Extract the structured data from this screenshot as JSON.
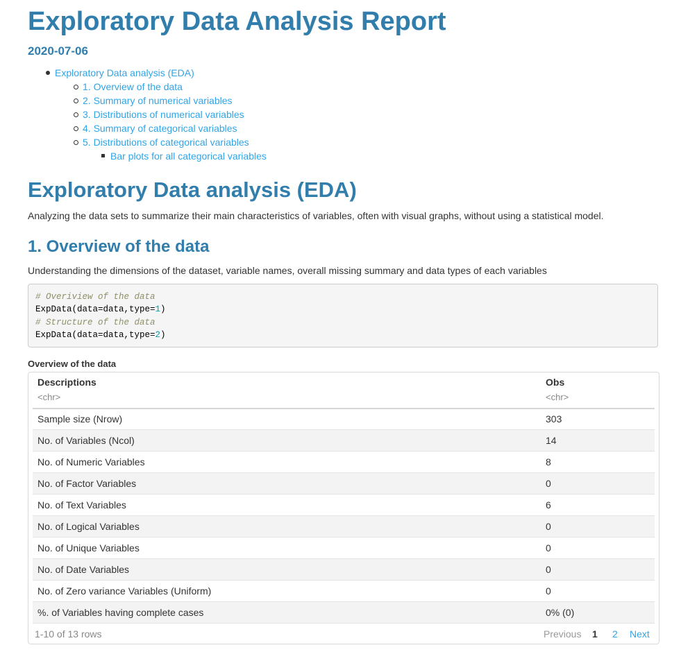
{
  "title": "Exploratory Data Analysis Report",
  "date": "2020-07-06",
  "toc": {
    "items": [
      {
        "label": "Exploratory Data analysis (EDA)"
      },
      {
        "label": "1. Overview of the data"
      },
      {
        "label": "2. Summary of numerical variables"
      },
      {
        "label": "3. Distributions of numerical variables"
      },
      {
        "label": "4. Summary of categorical variables"
      },
      {
        "label": "5. Distributions of categorical variables"
      },
      {
        "label": "Bar plots for all categorical variables"
      }
    ]
  },
  "eda": {
    "heading": "Exploratory Data analysis (EDA)",
    "description": "Analyzing the data sets to summarize their main characteristics of variables, often with visual graphs, without using a statistical model."
  },
  "overview": {
    "heading": "1. Overview of the data",
    "description": "Understanding the dimensions of the dataset, variable names, overall missing summary and data types of each variables",
    "code": {
      "comment1": "# Overiview of the data",
      "line1_prefix": "ExpData(data=data,type=",
      "line1_num": "1",
      "line1_suffix": ")",
      "comment2": "# Structure of the data",
      "line2_prefix": "ExpData(data=data,type=",
      "line2_num": "2",
      "line2_suffix": ")"
    },
    "table_caption": "Overview of the data"
  },
  "table": {
    "columns": [
      {
        "name": "Descriptions",
        "type": "<chr>"
      },
      {
        "name": "Obs",
        "type": "<chr>"
      }
    ],
    "rows": [
      [
        "Sample size (Nrow)",
        "303"
      ],
      [
        "No. of Variables (Ncol)",
        "14"
      ],
      [
        "No. of Numeric Variables",
        "8"
      ],
      [
        "No. of Factor Variables",
        "0"
      ],
      [
        "No. of Text Variables",
        "6"
      ],
      [
        "No. of Logical Variables",
        "0"
      ],
      [
        "No. of Unique Variables",
        "0"
      ],
      [
        "No. of Date Variables",
        "0"
      ],
      [
        "No. of Zero variance Variables (Uniform)",
        "0"
      ],
      [
        "%. of Variables having complete cases",
        "0% (0)"
      ]
    ],
    "rows_info": "1-10 of 13 rows",
    "pager": {
      "previous": "Previous",
      "page1": "1",
      "page2": "2",
      "next": "Next"
    }
  }
}
